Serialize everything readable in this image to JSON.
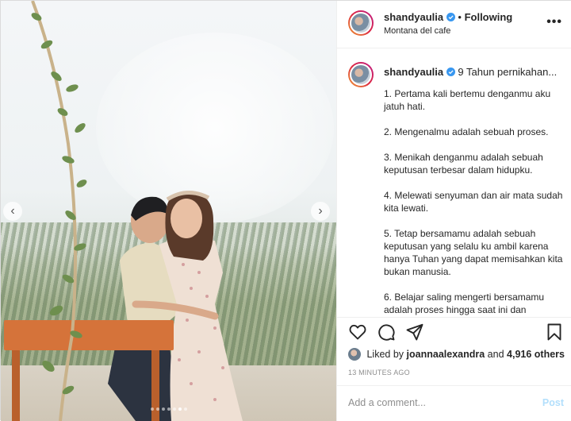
{
  "post": {
    "username": "shandyaulia",
    "follow_separator": "•",
    "follow_label": "Following",
    "location": "Montana del cafe",
    "more_label": "•••"
  },
  "photo": {
    "prev_label": "‹",
    "next_label": "›",
    "carousel_total": 7,
    "carousel_active": 6
  },
  "caption": {
    "username": "shandyaulia",
    "lead": "9 Tahun pernikahan...",
    "paragraphs": [
      "1. Pertama kali bertemu denganmu aku jatuh hati.",
      "2. Mengenalmu adalah sebuah proses.",
      "3. Menikah denganmu adalah sebuah keputusan terbesar dalam hidupku.",
      "4. Melewati senyuman dan air mata sudah kita lewati.",
      "5. Tetap bersamamu adalah sebuah keputusan yang selalu ku ambil karena hanya Tuhan yang dapat memisahkan kita bukan manusia.",
      "6. Belajar saling mengerti bersamamu adalah proses hingga saat ini dan"
    ]
  },
  "actions": {
    "like_icon": "heart-icon",
    "comment_icon": "comment-icon",
    "share_icon": "share-icon",
    "save_icon": "bookmark-icon"
  },
  "likes": {
    "prefix": "Liked by",
    "user": "joannaalexandra",
    "connector": "and",
    "others": "4,916 others"
  },
  "timestamp": "13 MINUTES AGO",
  "comment": {
    "placeholder": "Add a comment...",
    "post_label": "Post"
  },
  "colors": {
    "verified": "#3897f0",
    "post_button_disabled": "#b2dffc",
    "muted_text": "#8e8e8e"
  }
}
